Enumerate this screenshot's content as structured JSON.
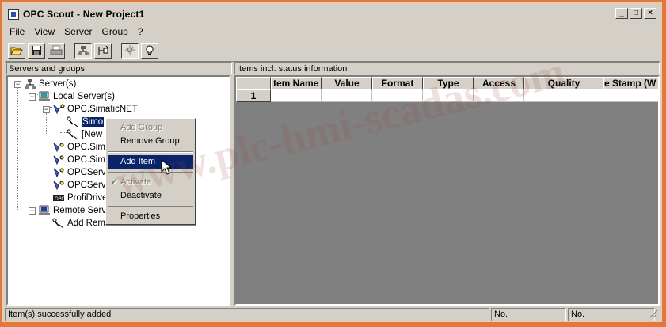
{
  "window": {
    "title": "OPC Scout - New Project1"
  },
  "win_controls": {
    "minimize": "_",
    "maximize": "□",
    "close": "×"
  },
  "menu": {
    "items": [
      "File",
      "View",
      "Server",
      "Group",
      "?"
    ]
  },
  "toolbar": {
    "icons": [
      "open-folder-icon",
      "save-disk-icon",
      "print-icon",
      "servers-network-icon",
      "add-item-tree-icon",
      "monitor-light-icon",
      "lightbulb-icon"
    ]
  },
  "left_pane": {
    "header": "Servers and groups"
  },
  "tree": {
    "root": "Server(s)",
    "local": "Local Server(s)",
    "opc_simatic": "OPC.SimaticNET",
    "simo_group": "Simo",
    "new_group": "[New",
    "opc_sim1": "OPC.Sim",
    "opc_sim2": "OPC.Sim",
    "opc_serv1": "OPCServ",
    "opc_serv2": "OPCServ",
    "profidrive": "ProfiDrive",
    "remote": "Remote Serv",
    "add_remote": "Add Rem"
  },
  "right_pane": {
    "header": "Items incl. status information"
  },
  "grid": {
    "columns": [
      "tem Name",
      "Value",
      "Format",
      "Type",
      "Access",
      "Quality",
      "e Stamp (W"
    ],
    "rows": [
      {
        "num": "1"
      }
    ]
  },
  "context_menu": {
    "add_group": "Add Group",
    "remove_group": "Remove Group",
    "add_item": "Add Item",
    "activate": "Activate",
    "check": "✔",
    "deactivate": "Deactivate",
    "properties": "Properties"
  },
  "status": {
    "message": "Item(s) successfully added",
    "no1": "No.",
    "no2": "No."
  },
  "watermark": "www.plc-hmi-scadas.com",
  "colors": {
    "selection": "#0a246a",
    "chrome": "#d4d0c8",
    "outer_frame": "#e07a3c"
  }
}
